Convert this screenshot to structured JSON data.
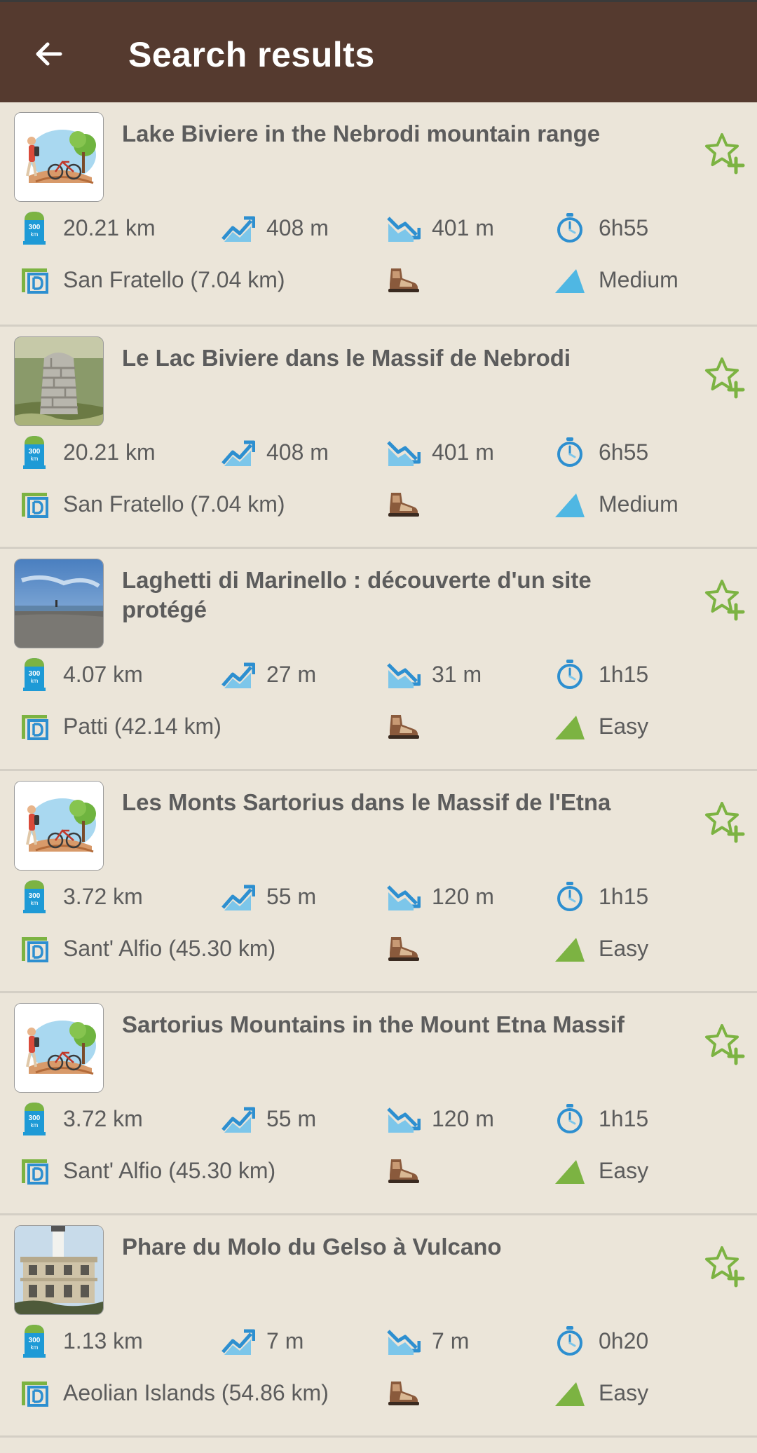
{
  "header": {
    "title": "Search results"
  },
  "colors": {
    "appbar": "#553a2f",
    "background": "#ebe5d9",
    "accent_green": "#7cb342",
    "accent_blue": "#4aa8d8"
  },
  "results": [
    {
      "title": "Lake Biviere in the Nebrodi mountain range",
      "thumbnail": "illustration-hiker-bike",
      "distance": "20.21 km",
      "ascent": "408 m",
      "descent": "401 m",
      "duration": "6h55",
      "start": "San Fratello (7.04 km)",
      "difficulty": "Medium",
      "difficulty_color": "#4fb7e3"
    },
    {
      "title": "Le Lac Biviere dans le Massif de Nebrodi",
      "thumbnail": "photo-stone-cairn",
      "distance": "20.21 km",
      "ascent": "408 m",
      "descent": "401 m",
      "duration": "6h55",
      "start": "San Fratello (7.04 km)",
      "difficulty": "Medium",
      "difficulty_color": "#4fb7e3"
    },
    {
      "title": "Laghetti di Marinello : découverte d'un site protégé",
      "thumbnail": "photo-coast-sky",
      "distance": "4.07 km",
      "ascent": "27 m",
      "descent": "31 m",
      "duration": "1h15",
      "start": "Patti (42.14 km)",
      "difficulty": "Easy",
      "difficulty_color": "#7cb342"
    },
    {
      "title": "Les Monts Sartorius dans le Massif de l'Etna",
      "thumbnail": "illustration-hiker-bike",
      "distance": "3.72 km",
      "ascent": "55 m",
      "descent": "120 m",
      "duration": "1h15",
      "start": "Sant' Alfio (45.30 km)",
      "difficulty": "Easy",
      "difficulty_color": "#7cb342"
    },
    {
      "title": "Sartorius Mountains in the Mount Etna Massif",
      "thumbnail": "illustration-hiker-bike",
      "distance": "3.72 km",
      "ascent": "55 m",
      "descent": "120 m",
      "duration": "1h15",
      "start": "Sant' Alfio (45.30 km)",
      "difficulty": "Easy",
      "difficulty_color": "#7cb342"
    },
    {
      "title": "Phare du Molo du Gelso à Vulcano",
      "thumbnail": "photo-lighthouse-building",
      "distance": "1.13 km",
      "ascent": "7 m",
      "descent": "7 m",
      "duration": "0h20",
      "start": "Aeolian Islands (54.86 km)",
      "difficulty": "Easy",
      "difficulty_color": "#7cb342"
    }
  ],
  "icons": {
    "back": "arrow-left-icon",
    "favorite": "star-plus-icon",
    "distance": "distance-marker-icon",
    "ascent": "ascent-icon",
    "descent": "descent-icon",
    "duration": "stopwatch-icon",
    "start": "departure-icon",
    "practice": "hiking-boot-icon",
    "difficulty": "difficulty-mountain-icon"
  },
  "distance_icon_text": {
    "top": "300",
    "bottom": "km"
  }
}
